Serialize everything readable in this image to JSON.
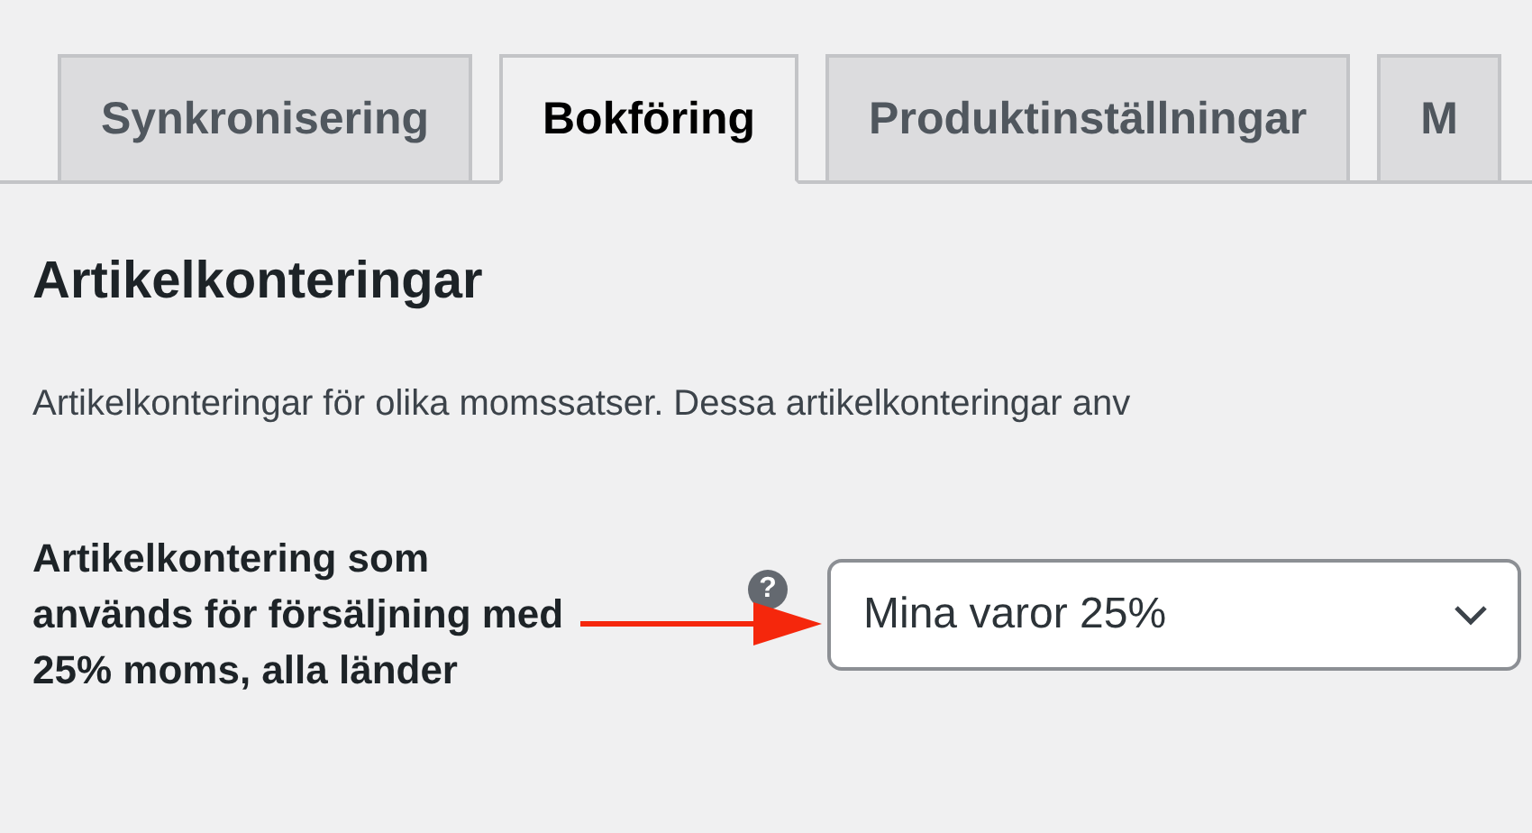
{
  "tabs": [
    {
      "label": "Synkronisering",
      "selected": false
    },
    {
      "label": "Bokföring",
      "selected": true
    },
    {
      "label": "Produktinställningar",
      "selected": false
    },
    {
      "label": "M",
      "selected": false
    }
  ],
  "section": {
    "title": "Artikelkonteringar",
    "description": "Artikelkonteringar för olika momssatser. Dessa artikelkonteringar anv"
  },
  "field": {
    "label": "Artikelkontering som används för försäljning med 25% moms, alla länder",
    "help": "?",
    "value": "Mina varor 25%"
  }
}
